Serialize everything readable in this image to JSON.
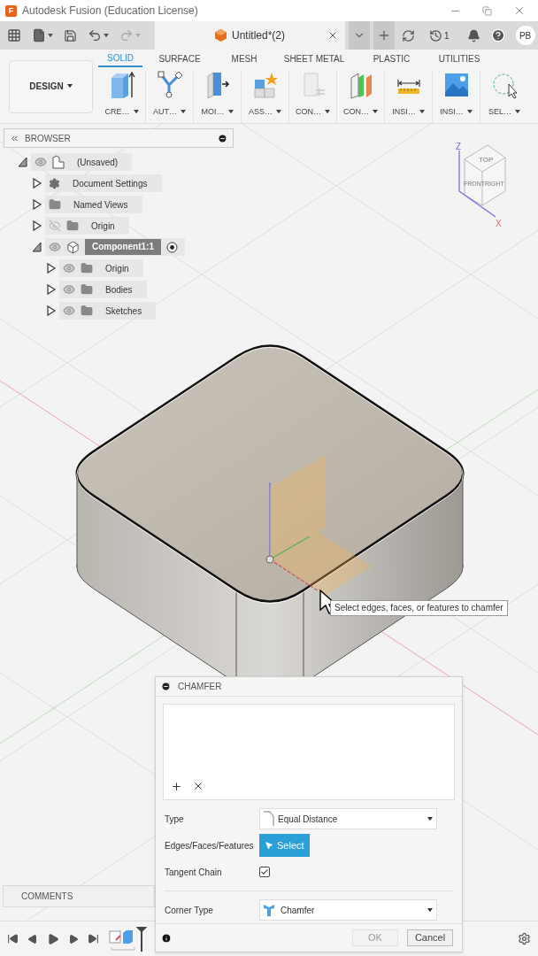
{
  "window": {
    "logo_letter": "F",
    "title": "Autodesk Fusion (Education License)"
  },
  "tab_bar": {
    "document_tab": "Untitled*(2)",
    "job_count": "1",
    "user_initials": "PB"
  },
  "ribbon": {
    "workspace": "DESIGN",
    "tabs": [
      {
        "label": "SOLID",
        "selected": true
      },
      {
        "label": "SURFACE",
        "selected": false
      },
      {
        "label": "MESH",
        "selected": false
      },
      {
        "label": "SHEET METAL",
        "selected": false
      },
      {
        "label": "PLASTIC",
        "selected": false
      },
      {
        "label": "UTILITIES",
        "selected": false
      }
    ],
    "tools": [
      {
        "kind": "create",
        "label": "CRE…"
      },
      {
        "kind": "automate",
        "label": "AUT…"
      },
      {
        "kind": "modify",
        "label": "MOI…"
      },
      {
        "kind": "assemble",
        "label": "ASS…"
      },
      {
        "kind": "construct",
        "label": "CON…"
      },
      {
        "kind": "planes",
        "label": "CON…"
      },
      {
        "kind": "inspect",
        "label": "INSI…"
      },
      {
        "kind": "insert",
        "label": "INSI…"
      },
      {
        "kind": "select",
        "label": "SEL…"
      }
    ]
  },
  "browser": {
    "title": "BROWSER",
    "tree": [
      {
        "label": "(Unsaved)",
        "kind": "document",
        "eye_toggle": true,
        "visible": true,
        "expanded": true,
        "selected": false,
        "active": false,
        "children": [
          {
            "label": "Document Settings",
            "kind": "settings",
            "eye_toggle": false,
            "expanded": false,
            "selected": false,
            "active": false
          },
          {
            "label": "Named Views",
            "kind": "folder",
            "eye_toggle": false,
            "expanded": false,
            "selected": false,
            "active": false
          },
          {
            "label": "Origin",
            "kind": "folder",
            "eye_toggle": true,
            "visible": false,
            "expanded": false,
            "selected": false,
            "active": false
          },
          {
            "label": "Component1:1",
            "kind": "component",
            "eye_toggle": true,
            "visible": true,
            "expanded": true,
            "selected": true,
            "active": true,
            "children": [
              {
                "label": "Origin",
                "kind": "folder",
                "eye_toggle": true,
                "visible": true,
                "expanded": false,
                "selected": false,
                "active": false
              },
              {
                "label": "Bodies",
                "kind": "folder",
                "eye_toggle": true,
                "visible": true,
                "expanded": false,
                "selected": false,
                "active": false
              },
              {
                "label": "Sketches",
                "kind": "folder",
                "eye_toggle": true,
                "visible": true,
                "expanded": false,
                "selected": false,
                "active": false
              }
            ]
          }
        ]
      }
    ]
  },
  "view_cube": {
    "top": "TOP",
    "front": "FRONT",
    "right": "RIGHT",
    "z_axis": "Z",
    "x_axis": "X"
  },
  "tooltip": "Select edges, faces, or features to chamfer",
  "chamfer_dialog": {
    "title": "CHAMFER",
    "type": {
      "label": "Type",
      "value": "Equal Distance"
    },
    "selection": {
      "label": "Edges/Faces/Features",
      "button": "Select",
      "active": true
    },
    "tangent_chain": {
      "label": "Tangent Chain",
      "checked": true
    },
    "corner_type": {
      "label": "Corner Type",
      "value": "Chamfer"
    },
    "buttons": [
      {
        "label": "OK",
        "disabled": true
      },
      {
        "label": "Cancel",
        "disabled": false
      }
    ]
  },
  "comments": {
    "title": "COMMENTS"
  }
}
